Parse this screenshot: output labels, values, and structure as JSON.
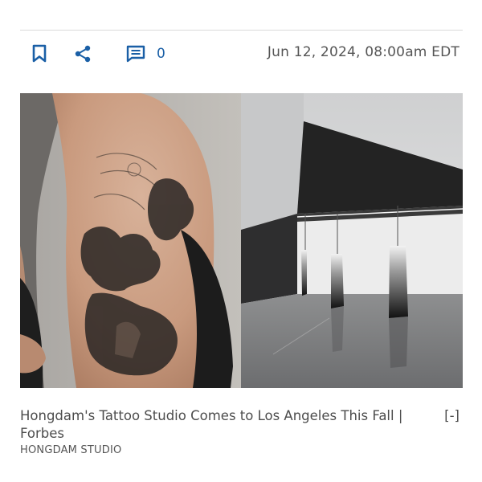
{
  "toolbar": {
    "comment_count": "0",
    "timestamp": "Jun 12, 2024, 08:00am EDT",
    "accent_color": "#1a5fa6"
  },
  "icons": {
    "bookmark": "bookmark-icon",
    "share": "share-icon",
    "comment": "comment-icon"
  },
  "figure": {
    "caption": "Hongdam's Tattoo Studio Comes to Los Angeles This Fall | Forbes",
    "toggle_label": "[-]",
    "credit": "HONGDAM STUDIO"
  }
}
